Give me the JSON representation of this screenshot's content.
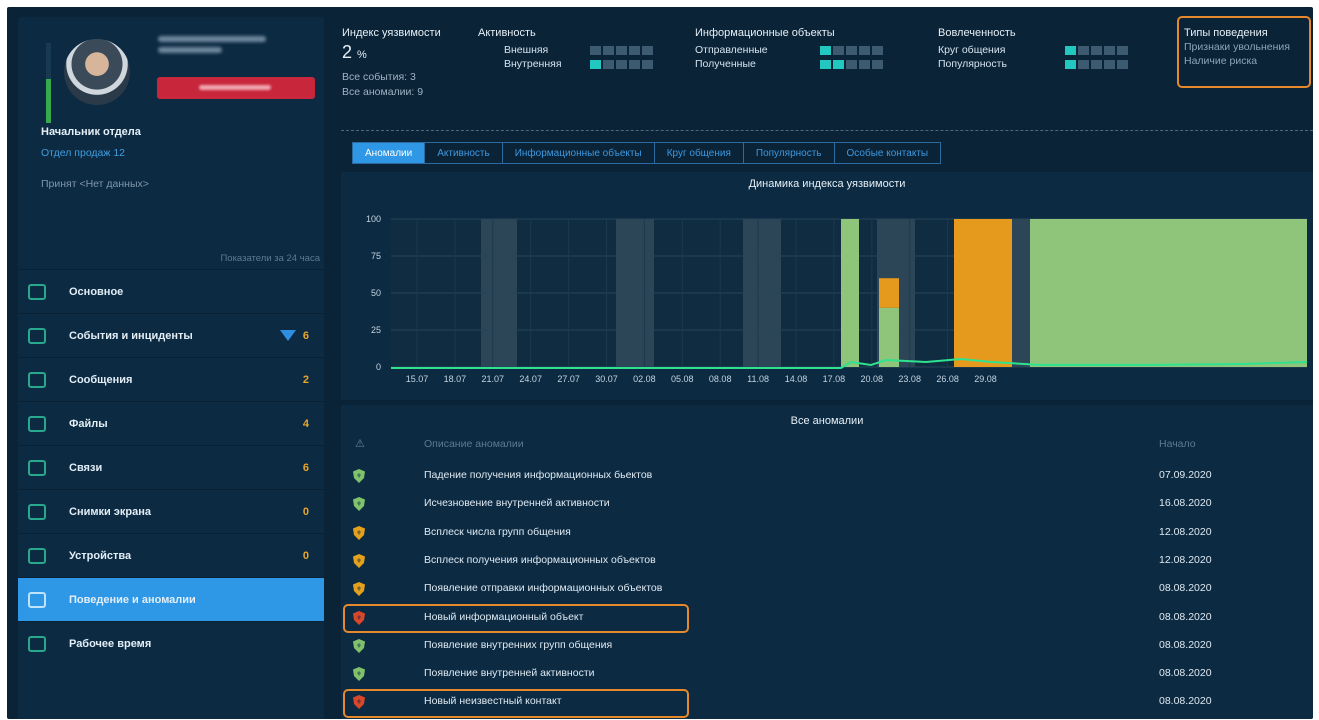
{
  "profile": {
    "position": "Начальник отдела",
    "department": "Отдел продаж 12",
    "hired": "Принят <Нет данных>",
    "activity_level": 0.55
  },
  "sidebar": {
    "period": "Показатели за 24 часа",
    "items": [
      {
        "label": "Основное",
        "count": "",
        "icon": "shield-icon"
      },
      {
        "label": "События и инциденты",
        "count": "6",
        "icon": "events-icon"
      },
      {
        "label": "Сообщения",
        "count": "2",
        "icon": "message-icon"
      },
      {
        "label": "Файлы",
        "count": "4",
        "icon": "file-icon"
      },
      {
        "label": "Связи",
        "count": "6",
        "icon": "network-icon"
      },
      {
        "label": "Снимки экрана",
        "count": "0",
        "icon": "screenshot-icon"
      },
      {
        "label": "Устройства",
        "count": "0",
        "icon": "usb-icon"
      },
      {
        "label": "Поведение и аномалии",
        "count": "",
        "icon": "behavior-icon"
      },
      {
        "label": "Рабочее время",
        "count": "",
        "icon": "calendar-icon"
      }
    ],
    "active_index": 7
  },
  "header": {
    "index": {
      "title": "Индекс уязвимости",
      "value": "2",
      "unit": "%",
      "events": "Все события: 3",
      "anomalies": "Все аномалии: 9"
    },
    "activity": {
      "title": "Активность",
      "external": "Внешняя",
      "internal": "Внутренняя",
      "external_level": 0,
      "internal_level": 1
    },
    "info_objects": {
      "title": "Информационные объекты",
      "sent": "Отправленные",
      "received": "Полученные",
      "sent_level": 1,
      "received_level": 2
    },
    "engagement": {
      "title": "Вовлеченность",
      "circle": "Круг общения",
      "popularity": "Популярность",
      "circle_level": 1,
      "popularity_level": 1
    },
    "behavior_types": {
      "title": "Типы поведения",
      "items": [
        "Признаки увольнения",
        "Наличие риска"
      ]
    }
  },
  "tabs": [
    "Аномалии",
    "Активность",
    "Информационные объекты",
    "Круг общения",
    "Популярность",
    "Особые контакты"
  ],
  "chart_data": {
    "type": "bar",
    "title": "Динамика индекса уязвимости",
    "xlabel": "",
    "ylabel": "",
    "ylim": [
      0,
      100
    ],
    "yticks": [
      "0",
      "25",
      "50",
      "75",
      "100"
    ],
    "xticks": [
      "15.07",
      "18.07",
      "21.07",
      "24.07",
      "27.07",
      "30.07",
      "02.08",
      "05.08",
      "08.08",
      "11.08",
      "14.08",
      "17.08",
      "20.08",
      "23.08",
      "26.08",
      "29.08"
    ],
    "grid": true,
    "colors": {
      "green": "#8fc47b",
      "orange": "#e59a1d",
      "shade": "#2c4657",
      "line": "#2ee28f"
    }
  },
  "anomalies": {
    "title": "Все аномалии",
    "col_desc": "Описание аномалии",
    "col_date": "Начало",
    "col_icon": "⚠",
    "rows": [
      {
        "desc": "Падение получения информационных бьектов",
        "date": "07.09.2020",
        "level": "green"
      },
      {
        "desc": "Исчезновение внутренней активности",
        "date": "16.08.2020",
        "level": "green"
      },
      {
        "desc": "Всплеск числа групп общения",
        "date": "12.08.2020",
        "level": "orange"
      },
      {
        "desc": "Всплеск получения информационных объектов",
        "date": "12.08.2020",
        "level": "orange"
      },
      {
        "desc": "Появление отправки информационных объектов",
        "date": "08.08.2020",
        "level": "orange"
      },
      {
        "desc": "Новый информационный объект",
        "date": "08.08.2020",
        "level": "red"
      },
      {
        "desc": "Появление внутренних групп общения",
        "date": "08.08.2020",
        "level": "green"
      },
      {
        "desc": "Появление внутренней активности",
        "date": "08.08.2020",
        "level": "green"
      },
      {
        "desc": "Новый неизвестный контакт",
        "date": "08.08.2020",
        "level": "red"
      }
    ]
  }
}
